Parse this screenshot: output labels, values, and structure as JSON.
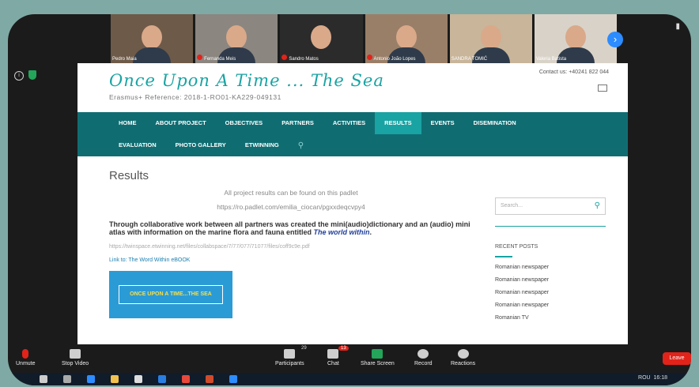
{
  "participants": [
    {
      "name": "Pedro Maia",
      "muted": false
    },
    {
      "name": "Fernanda Meis",
      "muted": true
    },
    {
      "name": "Sandro Matos",
      "muted": true
    },
    {
      "name": "Antonio João Lopes",
      "muted": true
    },
    {
      "name": "SANDRA TOMIĆ",
      "muted": false
    },
    {
      "name": "Valeria Batista",
      "muted": false
    }
  ],
  "website": {
    "logo": "Once Upon A Time ... The Sea",
    "reference": "Erasmus+ Reference: 2018-1-RO01-KA229-049131",
    "contact": "Contact us: +40241 822 044",
    "nav_row1": [
      "HOME",
      "ABOUT PROJECT",
      "OBJECTIVES",
      "PARTNERS",
      "ACTIVITIES",
      "RESULTS",
      "EVENTS",
      "DISEMINATION"
    ],
    "nav_row2": [
      "EVALUATION",
      "PHOTO GALLERY",
      "ETWINNING"
    ],
    "active_nav": "RESULTS",
    "page_title": "Results",
    "line1": "All project results can be found on this padlet",
    "line2": "https://ro.padlet.com/emilia_ciocan/pgxxdeqcvpy4",
    "bold_para": "Through collaborative work between all partners was created the mini(audio)dictionary and an (audio) mini atlas with information on the marine flora and fauna entitled",
    "bold_para_link": "The world within",
    "file_link": "https://twinspace.etwinning.net/files/collabspace/7/77/077/71077/files/coff9c9e.pdf",
    "ebook_link": "Link to: The Word Within eBOOK",
    "cover_text": "ONCE UPON A TIME...THE SEA",
    "search_placeholder": "Search...",
    "recent_posts_title": "RECENT POSTS",
    "recent_posts": [
      "Romanian newspaper",
      "Romanian newspaper",
      "Romanian newspaper",
      "Romanian newspaper",
      "Romanian TV"
    ]
  },
  "toolbar": {
    "unmute": "Unmute",
    "stop_video": "Stop Video",
    "participants": "Participants",
    "participants_count": "29",
    "chat": "Chat",
    "chat_badge": "13",
    "share_screen": "Share Screen",
    "record": "Record",
    "reactions": "Reactions",
    "leave": "Leave"
  },
  "taskbar": {
    "lang": "ROU",
    "time": "16:18"
  }
}
